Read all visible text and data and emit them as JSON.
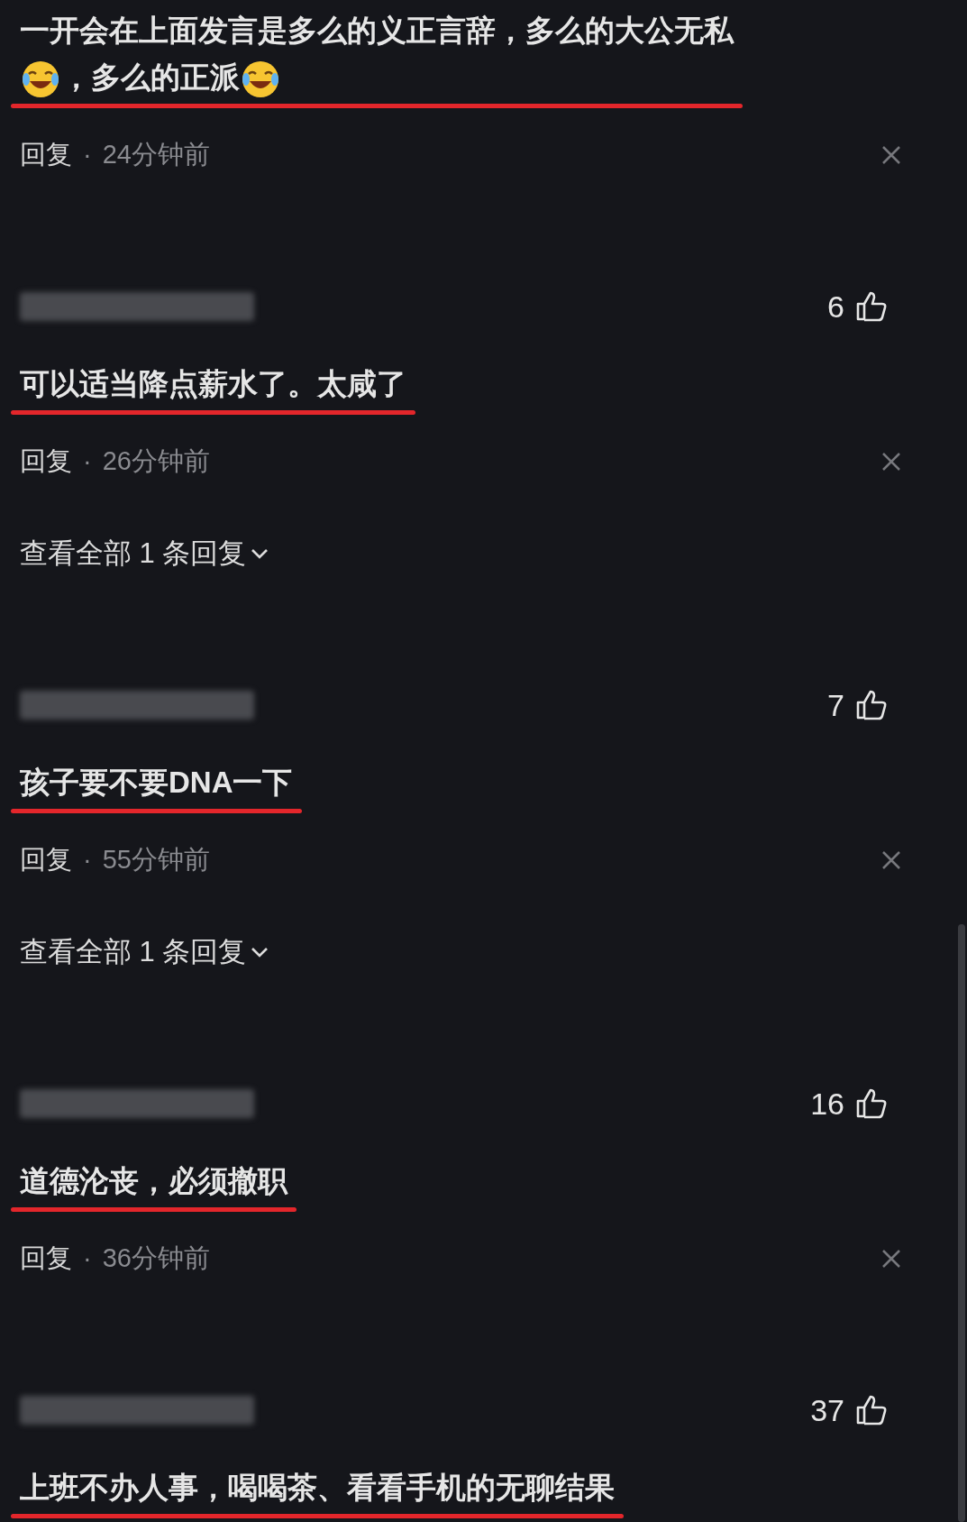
{
  "comments": [
    {
      "segments": [
        {
          "kind": "text",
          "text": "一开会在上面发言是多么的义正言辞，多么的大公无私"
        },
        {
          "kind": "break"
        },
        {
          "kind": "emoji"
        },
        {
          "kind": "text",
          "text": "，多么的正派"
        },
        {
          "kind": "emoji"
        }
      ],
      "underlined": true,
      "reply": "回复",
      "dot": "·",
      "time": "24分钟前"
    },
    {
      "likes": "6",
      "segments": [
        {
          "kind": "text",
          "text": "可以适当降点薪水了。太咸了"
        }
      ],
      "underlined": true,
      "reply": "回复",
      "dot": "·",
      "time": "26分钟前",
      "view_replies": "查看全部 1 条回复"
    },
    {
      "likes": "7",
      "segments": [
        {
          "kind": "text",
          "text": "孩子要不要DNA一下"
        }
      ],
      "underlined": true,
      "reply": "回复",
      "dot": "·",
      "time": "55分钟前",
      "view_replies": "查看全部 1 条回复"
    },
    {
      "likes": "16",
      "segments": [
        {
          "kind": "text",
          "text": "道德沦丧，必须撤职"
        }
      ],
      "underlined": true,
      "reply": "回复",
      "dot": "·",
      "time": "36分钟前"
    },
    {
      "likes": "37",
      "segments": [
        {
          "kind": "text",
          "text": "上班不办人事，喝喝茶、看看手机的无聊结果"
        }
      ],
      "underlined": true
    }
  ]
}
